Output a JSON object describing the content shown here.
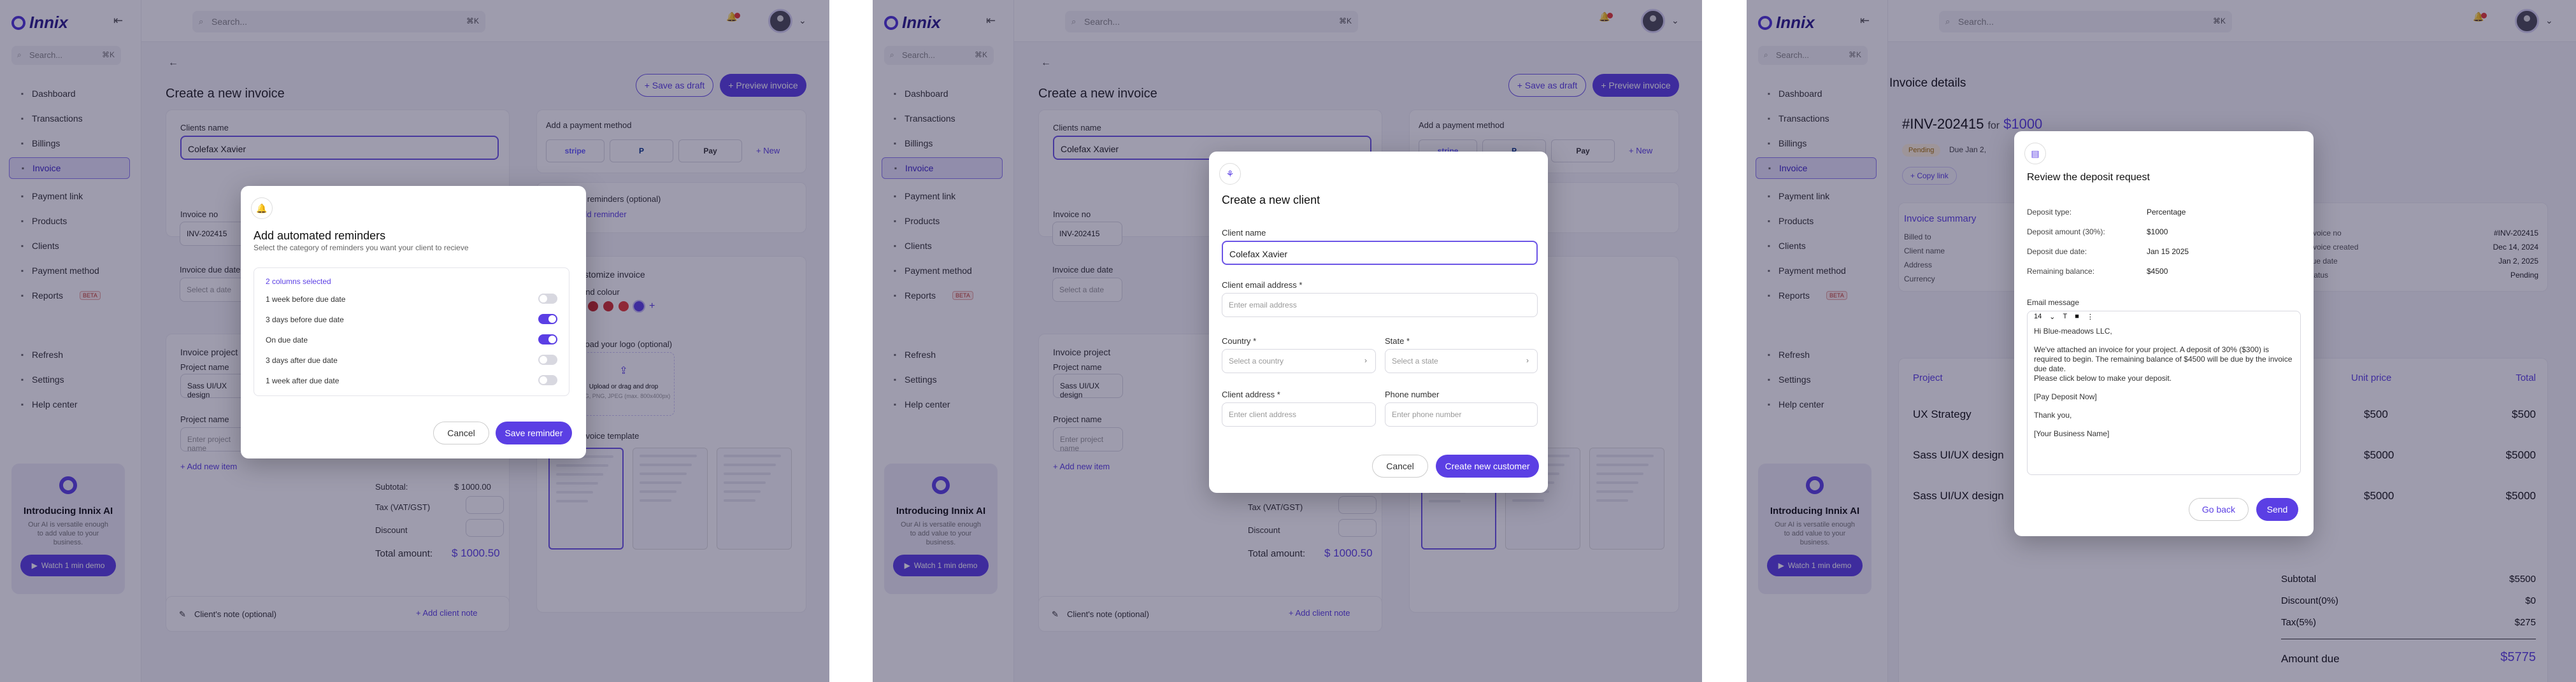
{
  "sidebar": {
    "brand": "Innix",
    "search_placeholder": "Search...",
    "search_kbd": "⌘K",
    "items": [
      {
        "label": "Dashboard",
        "icon": "grid-icon"
      },
      {
        "label": "Transactions",
        "icon": "arrows-icon"
      },
      {
        "label": "Billings",
        "icon": "card-icon"
      },
      {
        "label": "Invoice",
        "icon": "file-icon"
      },
      {
        "label": "Payment link",
        "icon": "link-icon"
      },
      {
        "label": "Products",
        "icon": "box-icon"
      },
      {
        "label": "Clients",
        "icon": "users-icon"
      },
      {
        "label": "Payment method",
        "icon": "wallet-icon"
      },
      {
        "label": "Reports",
        "icon": "chart-icon",
        "badge": "BETA"
      }
    ],
    "bottom": [
      {
        "label": "Refresh"
      },
      {
        "label": "Settings"
      },
      {
        "label": "Help center"
      }
    ],
    "promo": {
      "title": "Introducing Innix AI",
      "subtitle": "Our AI is versatile enough to add value to your business.",
      "button": "Watch 1 min demo"
    }
  },
  "topbar": {
    "search_placeholder": "Search...",
    "search_kbd": "⌘K"
  },
  "editor": {
    "title": "Create a new invoice",
    "save_draft": "+ Save as draft",
    "preview": "+ Preview invoice",
    "clients_label": "Clients name",
    "client_value": "Colefax Xavier",
    "payment_method": "Add a payment method",
    "new_label": "+ New",
    "stripe": "stripe",
    "paypal": "P",
    "apple_pay": "Pay",
    "invoice_no_label": "Invoice no",
    "invoice_no": "INV-202415",
    "due_label": "Invoice due date",
    "due_ph": "Select a date",
    "reminders": "Add reminders (optional)",
    "add_reminder": "+ Add reminder",
    "project_section": "Invoice project",
    "project_name_label": "Project name",
    "project_name": "Sass UI/UX design",
    "project_ph": "Enter project name",
    "add_item": "+ Add new item",
    "subtotal": "Subtotal:",
    "subtotal_v": "$ 1000.00",
    "tax": "Tax (VAT/GST)",
    "discount": "Discount",
    "total": "Total amount:",
    "total_v": "$ 1000.50",
    "customize": "Customize invoice",
    "brand_colour": "Brand colour",
    "upload_logo": "Upload your logo (optional)",
    "upload_text": "Upload or drag and drop",
    "upload_hint": "SVG, PNG, JPEG (max. 800x400px)",
    "template": "Choose invoice template",
    "client_note": "Client's note (optional)",
    "add_note": "+ Add client note"
  },
  "screen1_modal": {
    "title": "Add automated reminders",
    "subtitle": "Select the category of reminders you want your client to recieve",
    "selected": "2 columns selected",
    "options": [
      {
        "label": "1 week before due date",
        "on": false
      },
      {
        "label": "3 days before due date",
        "on": true
      },
      {
        "label": "On due date",
        "on": true
      },
      {
        "label": "3 days after due date",
        "on": false
      },
      {
        "label": "1 week after due date",
        "on": false
      }
    ],
    "cancel": "Cancel",
    "save": "Save reminder"
  },
  "screen2_modal": {
    "title": "Create a new client",
    "client_name_label": "Client name",
    "client_name": "Colefax Xavier",
    "email_label": "Client email address *",
    "email_ph": "Enter email address",
    "country_label": "Country *",
    "country_ph": "Select a country",
    "state_label": "State *",
    "state_ph": "Select a state",
    "address_label": "Client address *",
    "address_ph": "Enter client address",
    "phone_label": "Phone number",
    "phone_ph": "Enter phone number",
    "cancel": "Cancel",
    "create": "Create new customer"
  },
  "details": {
    "title": "Invoice details",
    "inv_no": "#INV-202415",
    "for": "for",
    "amount": "$1000",
    "status": "Pending",
    "due": "Due Jan 2,",
    "copy_link": "+ Copy link",
    "summary": "Invoice summary",
    "billed_to": "Billed to",
    "client_name": "Client name",
    "address": "Address",
    "currency": "Currency",
    "right_kv": [
      {
        "k": "Invoice no",
        "v": "#INV-202415"
      },
      {
        "k": "Invoice created",
        "v": "Dec 14, 2024"
      },
      {
        "k": "Due date",
        "v": "Jan 2, 2025"
      },
      {
        "k": "Status",
        "v": "Pending"
      }
    ],
    "table": {
      "headers": [
        "Project",
        "Unit price",
        "Total"
      ],
      "rows": [
        {
          "project": "UX Strategy",
          "unit": "$500",
          "total": "$500"
        },
        {
          "project": "Sass UI/UX design",
          "unit": "$5000",
          "total": "$5000"
        },
        {
          "project": "Sass UI/UX design",
          "unit": "$5000",
          "total": "$5000"
        }
      ]
    },
    "subtotal": "Subtotal",
    "subtotal_v": "$5500",
    "discount": "Discount(0%)",
    "discount_v": "$0",
    "tax": "Tax(5%)",
    "tax_v": "$275",
    "amount_due": "Amount due",
    "amount_due_v": "$5775"
  },
  "screen3_modal": {
    "title": "Review the deposit request",
    "rows": [
      {
        "k": "Deposit type:",
        "v": "Percentage"
      },
      {
        "k": "Deposit amount (30%):",
        "v": "$1000"
      },
      {
        "k": "Deposit due date:",
        "v": "Jan 15 2025"
      },
      {
        "k": "Remaining balance:",
        "v": "$4500"
      }
    ],
    "email_label": "Email message",
    "font_size": "14",
    "message": [
      "Hi Blue-meadows LLC,",
      "",
      "We've attached an invoice for your project. A deposit of 30% ($300) is required to begin. The remaining balance of $4500 will be due by the invoice due date.",
      "Please click below to make your deposit.",
      "",
      "[Pay Deposit Now]",
      "",
      "Thank you,",
      "",
      "[Your Business Name]"
    ],
    "back": "Go back",
    "send": "Send"
  },
  "colors": {
    "accent": "#5b3fe4",
    "overlay": "rgba(25,20,60,0.42)",
    "amount_due": "#5b3fe4"
  }
}
